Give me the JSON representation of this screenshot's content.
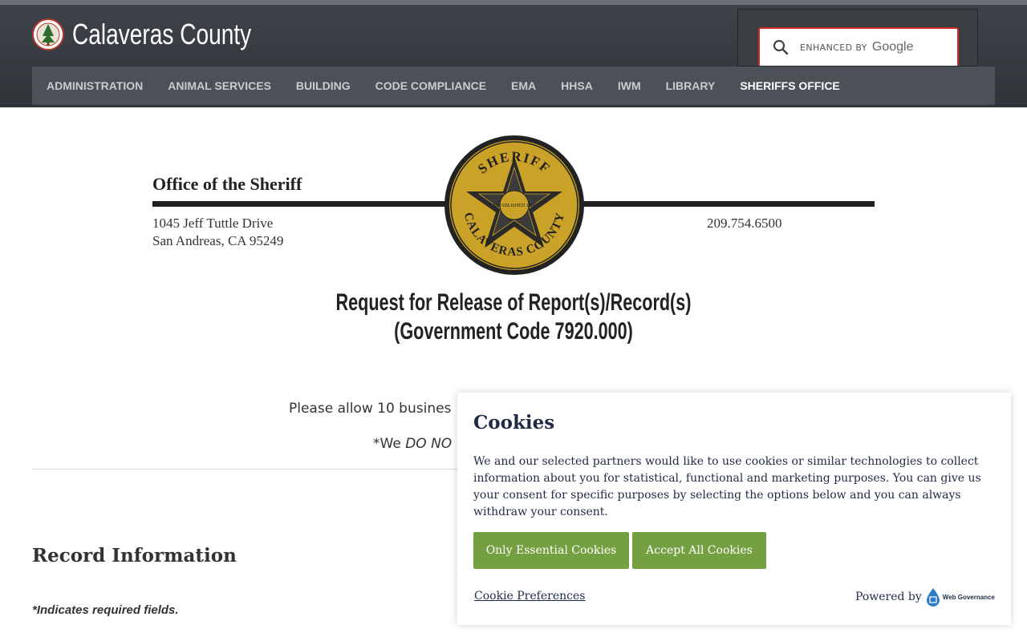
{
  "header": {
    "site_name": "Calaveras County",
    "search": {
      "enhanced_label": "ENHANCED BY",
      "google_label": "Google"
    }
  },
  "nav": {
    "items": [
      {
        "label": "ADMINISTRATION"
      },
      {
        "label": "ANIMAL SERVICES"
      },
      {
        "label": "BUILDING"
      },
      {
        "label": "CODE COMPLIANCE"
      },
      {
        "label": "EMA"
      },
      {
        "label": "HHSA"
      },
      {
        "label": "IWM"
      },
      {
        "label": "LIBRARY"
      },
      {
        "label": "SHERIFFS OFFICE",
        "active": true
      }
    ]
  },
  "letterhead": {
    "office_title": "Office of the Sheriff",
    "address_line1": "1045 Jeff Tuttle Drive",
    "address_line2": "San Andreas, CA 95249",
    "phone": "209.754.6500",
    "seal_top_text": "SHERIFF",
    "seal_bottom_text": "CALAVERAS COUNTY",
    "seal_established": "ESTABLISHED 1850"
  },
  "form_header": {
    "title_line1": "Request for Release of Report(s)/Record(s)",
    "title_line2": "(Government Code 7920.000)",
    "allow_text": "Please allow 10 busines",
    "we_prefix": "*We ",
    "we_emphasis": "DO NO"
  },
  "record_section": {
    "heading": "Record Information",
    "required_note": "*Indicates required fields."
  },
  "cookie_banner": {
    "title": "Cookies",
    "body": "We and our selected partners would like to use cookies or similar technologies to collect information about you for statistical, functional and marketing purposes. You can give us your consent for specific purposes by selecting the options below and you can always withdraw your consent.",
    "essential_button": "Only Essential Cookies",
    "accept_button": "Accept All Cookies",
    "preferences_link": "Cookie Preferences",
    "powered_by": "Powered by",
    "vendor_name": "Web Governance"
  },
  "colors": {
    "header_bg": "#353a3f",
    "nav_bg": "#4b5157",
    "search_border": "#d22a2a",
    "cookie_button": "#74a041",
    "seal_gold": "#c9a227"
  }
}
